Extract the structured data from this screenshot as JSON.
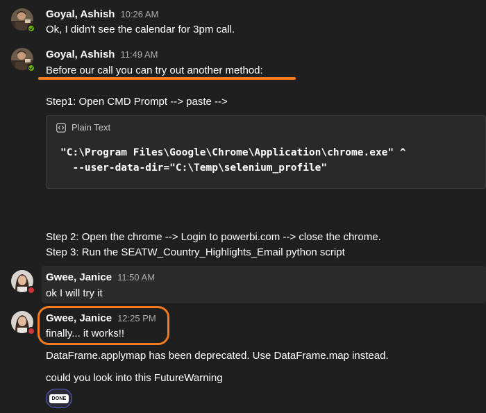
{
  "messages": [
    {
      "author": "Goyal, Ashish",
      "time": "10:26 AM",
      "presence": "available",
      "lines": [
        "Ok, I didn't see the calendar for 3pm call."
      ]
    },
    {
      "author": "Goyal, Ashish",
      "time": "11:49 AM",
      "presence": "available",
      "lines": [
        "Before our call you can try out another method:",
        "Step1: Open CMD Prompt --> paste -->",
        "Step 2: Open the chrome --> Login to powerbi.com --> close the chrome.",
        "Step 3: Run the SEATW_Country_Highlights_Email python script"
      ],
      "code_block": {
        "language": "Plain Text",
        "code": "\"C:\\Program Files\\Google\\Chrome\\Application\\chrome.exe\" ^\n  --user-data-dir=\"C:\\Temp\\selenium_profile\""
      }
    },
    {
      "author": "Gwee, Janice",
      "time": "11:50 AM",
      "presence": "busy",
      "lines": [
        "ok I will try it"
      ]
    },
    {
      "author": "Gwee, Janice",
      "time": "12:25 PM",
      "presence": "busy",
      "lines": [
        "finally... it works!!",
        "DataFrame.applymap has been deprecated. Use DataFrame.map instead.",
        "could you look into this FutureWarning"
      ],
      "reaction": "DONE"
    }
  ],
  "annotation_color": "#f47b20",
  "icons": {
    "code": "code-icon",
    "presence_available": "available-check-icon",
    "presence_busy": "busy-dot-icon"
  }
}
